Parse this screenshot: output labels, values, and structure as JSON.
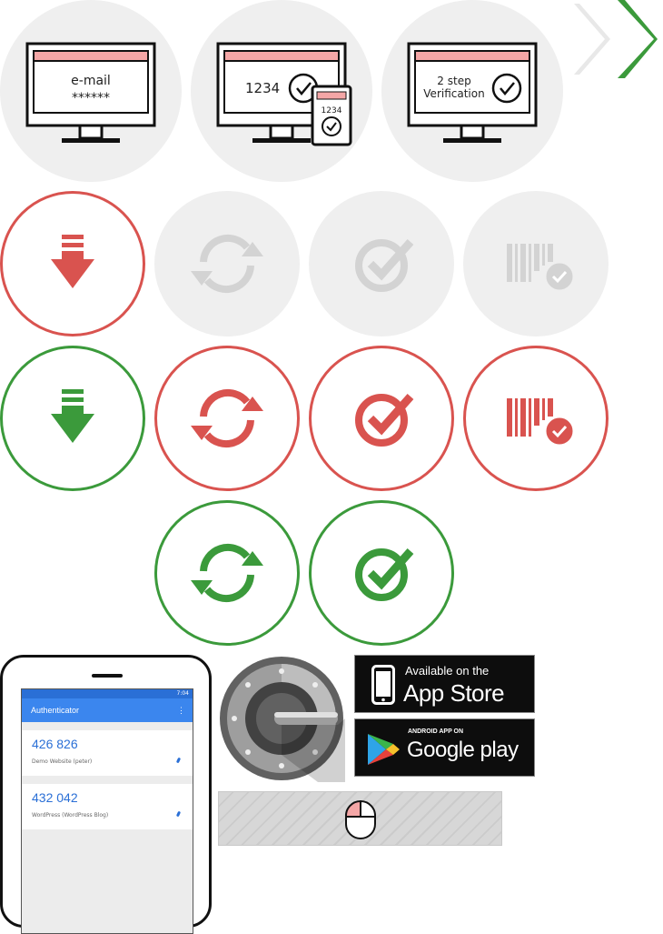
{
  "monitors": [
    {
      "line1": "e-mail",
      "line2": "******"
    },
    {
      "code": "1234",
      "phone_code": "1234"
    },
    {
      "line1": "2 step",
      "line2": "Verification"
    }
  ],
  "authenticator": {
    "status_time": "7:04",
    "title": "Authenticator",
    "menu": "⋮",
    "entries": [
      {
        "code": "426 826",
        "label": "Demo Website (peter)"
      },
      {
        "code": "432 042",
        "label": "WordPress (WordPress Blog)"
      }
    ]
  },
  "app_store": {
    "small": "Available on the",
    "big": "App Store"
  },
  "google_play": {
    "small": "ANDROID APP ON",
    "big": "Google play"
  },
  "colors": {
    "red": "#d9534f",
    "green": "#3b9a3b",
    "gray": "#d3d3d3",
    "disc": "#efefef",
    "pink": "#f4a6a6"
  },
  "icons": [
    "download-icon",
    "sync-icon",
    "check-icon",
    "barcode-check-icon",
    "mouse-icon",
    "chevron-right-icon"
  ]
}
